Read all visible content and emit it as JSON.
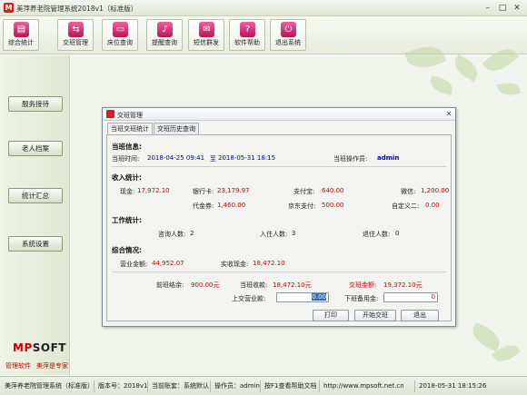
{
  "window": {
    "title": "美萍养老院管理系统2018v1（标准版）",
    "minimize": "–",
    "maximize": "□",
    "close": "✕"
  },
  "toolbar": [
    {
      "label": "综合统计",
      "icon": "chart-icon",
      "glyph": "▤"
    },
    {
      "label": "交班管理",
      "icon": "handover-icon",
      "glyph": "⇆"
    },
    {
      "label": "床位查询",
      "icon": "bed-icon",
      "glyph": "▭"
    },
    {
      "label": "提醒查询",
      "icon": "bell-icon",
      "glyph": "♪"
    },
    {
      "label": "短信群发",
      "icon": "mail-icon",
      "glyph": "✉"
    },
    {
      "label": "软件帮助",
      "icon": "help-icon",
      "glyph": "?"
    },
    {
      "label": "退出系统",
      "icon": "exit-icon",
      "glyph": "⏻"
    }
  ],
  "sidebar": {
    "items": [
      "服务接待",
      "老人档案",
      "统计汇总",
      "系统设置"
    ],
    "logo": "MPSOFT",
    "slogan_left": "管理软件",
    "slogan_right": "美萍是专家"
  },
  "dialog": {
    "title": "交班管理",
    "close": "✕",
    "tabs": [
      "当班交班统计",
      "交班历史查询"
    ],
    "shift_info": {
      "heading": "当班信息:",
      "time_label": "当班时间:",
      "time_start": "2018-04-25 09:41",
      "time_to": "至",
      "time_end": "2018-05-31 18:15",
      "operator_label": "当班操作员:",
      "operator": "admin"
    },
    "income": {
      "heading": "收入统计:",
      "cash_label": "现金:",
      "cash": "17,972.10",
      "bankcard_label": "银行卡:",
      "bankcard": "23,179.97",
      "alipay_label": "支付宝:",
      "alipay": "640.00",
      "wechat_label": "微信:",
      "wechat": "1,200.00",
      "voucher_label": "代金券:",
      "voucher": "1,460.00",
      "jd_label": "京东支付:",
      "jd": "500.00",
      "custom2_label": "自定义二:",
      "custom2": "0.00"
    },
    "work": {
      "heading": "工作统计:",
      "consult_label": "咨询人数:",
      "consult": "2",
      "checkin_label": "入住人数:",
      "checkin": "3",
      "checkout_label": "退住人数:",
      "checkout": "0"
    },
    "summary": {
      "heading": "综合情况:",
      "revenue_label": "营业金额:",
      "revenue": "44,952.07",
      "actual_cash_label": "实收现金:",
      "actual_cash": "18,472.10"
    },
    "handover": {
      "prev_label": "前班结余:",
      "prev": "900.00元",
      "current_label": "当班收款:",
      "current": "18,472.10元",
      "total_label": "交班金额:",
      "total": "19,372.10元",
      "submit_label": "上交营业款:",
      "submit_value": "0.00",
      "reserve_label": "下班备用金:",
      "reserve_value": "0"
    },
    "buttons": {
      "print": "打印",
      "start": "开始交班",
      "exit": "退出"
    }
  },
  "statusbar": [
    "美萍养老院管理系统（标准版）",
    "版本号：2018v1",
    "当前账套：系统默认",
    "操作员：admin",
    "按F1查看帮助文档",
    "http://www.mpsoft.net.cn",
    "2018-05-31 18:15:26"
  ]
}
